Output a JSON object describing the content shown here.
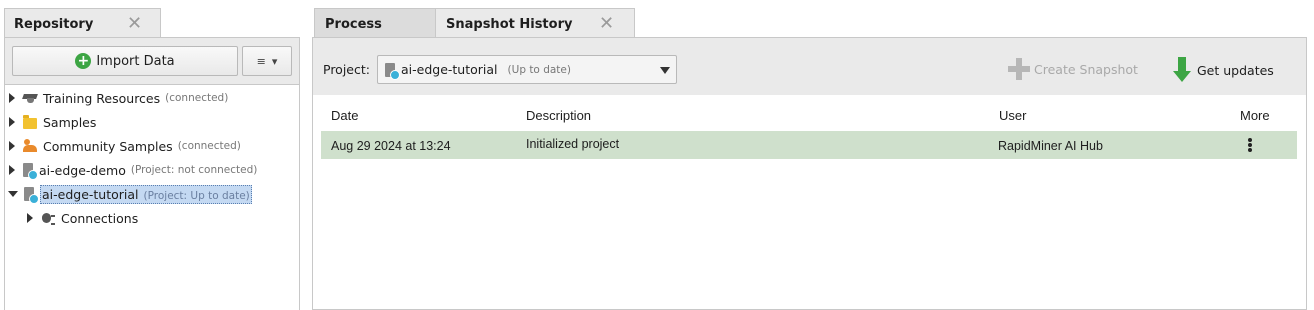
{
  "repository": {
    "tab_label": "Repository",
    "close_glyph": "✕",
    "import_label": "Import Data",
    "menu_glyph": "≡",
    "menu_arrow": "▾",
    "tree": [
      {
        "label": "Training Resources",
        "status": "(connected)",
        "icon": "graduation-cap-icon"
      },
      {
        "label": "Samples",
        "status": "",
        "icon": "folder-icon"
      },
      {
        "label": "Community Samples",
        "status": "(connected)",
        "icon": "people-icon"
      },
      {
        "label": "ai-edge-demo",
        "status": "(Project: not connected)",
        "icon": "project-icon"
      },
      {
        "label": "ai-edge-tutorial",
        "status": "(Project: Up to date)",
        "icon": "project-icon"
      },
      {
        "label": "Connections",
        "status": "",
        "icon": "plug-icon"
      }
    ]
  },
  "tabs": {
    "process": "Process",
    "snapshot_history": "Snapshot History",
    "close_glyph": "✕"
  },
  "toolbar": {
    "project_label": "Project:",
    "project_value": "ai-edge-tutorial",
    "project_status": "(Up to date)",
    "create_snapshot": "Create Snapshot",
    "get_updates": "Get updates"
  },
  "table": {
    "headers": {
      "date": "Date",
      "description": "Description",
      "user": "User",
      "more": "More"
    },
    "rows": [
      {
        "date": "Aug 29 2024 at 13:24",
        "description": "Initialized project",
        "user": "RapidMiner AI Hub"
      }
    ]
  },
  "colors": {
    "selected_row": "#cfe0cc",
    "accent_green": "#3da544",
    "selection_blue": "#c4d9f2"
  }
}
